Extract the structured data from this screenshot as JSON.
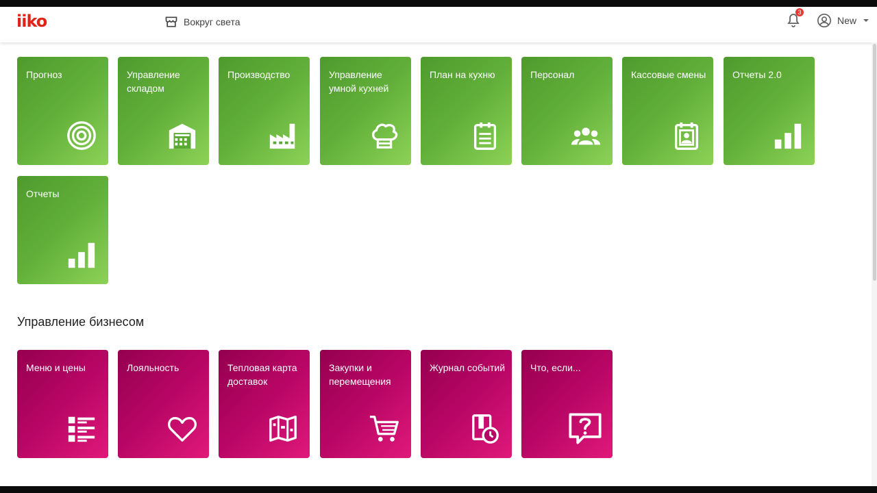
{
  "app": {
    "logo": "iiko"
  },
  "header": {
    "store_name": "Вокруг света",
    "notifications_count": "3",
    "user_name": "New"
  },
  "section1_tiles": [
    {
      "label": "Прогноз",
      "icon": "target-icon"
    },
    {
      "label": "Управление складом",
      "icon": "warehouse-icon"
    },
    {
      "label": "Производство",
      "icon": "factory-icon"
    },
    {
      "label": "Управление умной кухней",
      "icon": "chef-hat-icon"
    },
    {
      "label": "План на кухню",
      "icon": "clipboard-icon"
    },
    {
      "label": "Персонал",
      "icon": "people-icon"
    },
    {
      "label": "Кассовые смены",
      "icon": "badge-icon"
    },
    {
      "label": "Отчеты 2.0",
      "icon": "bar-chart-icon"
    },
    {
      "label": "Отчеты",
      "icon": "bar-chart-icon"
    }
  ],
  "section2": {
    "title": "Управление бизнесом",
    "tiles": [
      {
        "label": "Меню и цены",
        "icon": "list-icon"
      },
      {
        "label": "Лояльность",
        "icon": "heart-icon"
      },
      {
        "label": "Тепловая карта доставок",
        "icon": "map-icon"
      },
      {
        "label": "Закупки и перемещения",
        "icon": "cart-icon"
      },
      {
        "label": "Журнал событий",
        "icon": "log-clock-icon"
      },
      {
        "label": "Что, если...",
        "icon": "question-chat-icon"
      }
    ]
  },
  "colors": {
    "brand_red": "#e2231a",
    "tile_green": "#62b03a",
    "tile_magenta": "#b80665"
  }
}
